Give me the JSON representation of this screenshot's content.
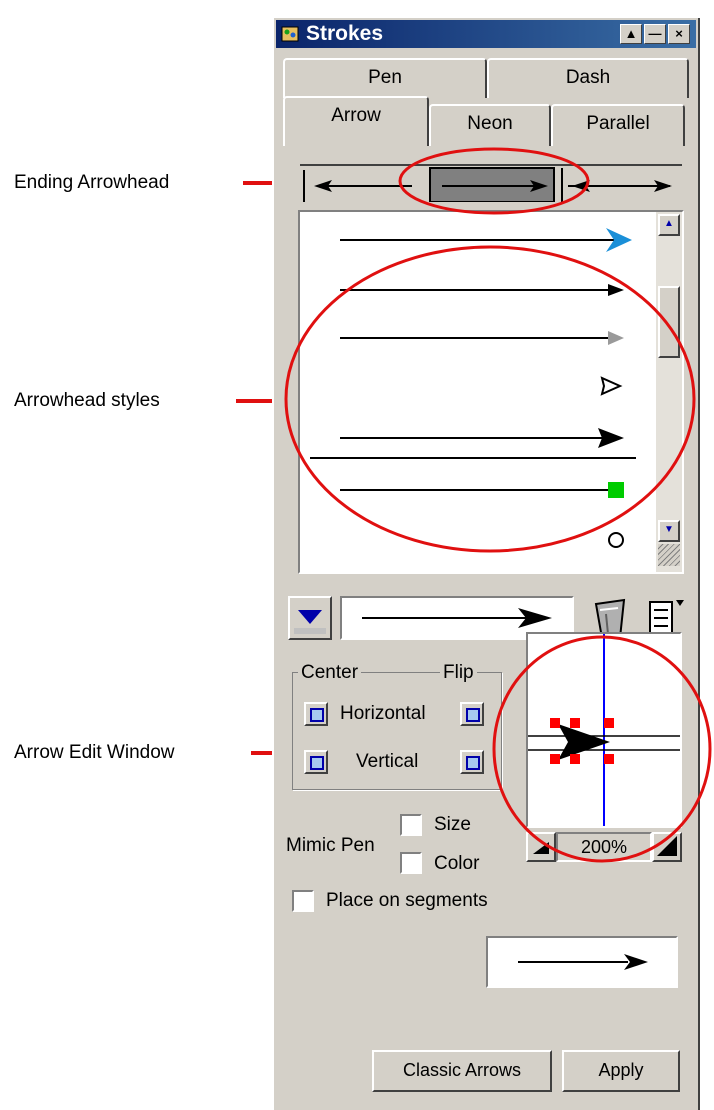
{
  "window": {
    "title": "Strokes",
    "icon": "paint-icon"
  },
  "tabs": {
    "row1": [
      {
        "label": "Pen"
      },
      {
        "label": "Dash"
      }
    ],
    "row2": [
      {
        "label": "Arrow"
      },
      {
        "label": "Neon"
      },
      {
        "label": "Parallel"
      }
    ]
  },
  "arrow_ends": [
    "start-arrowhead",
    "ending-arrowhead",
    "both-ends"
  ],
  "arrowhead_styles": [
    {
      "icon": "blue-arrowhead-icon",
      "color": "#1a8fd8"
    },
    {
      "icon": "black-small-arrowhead-icon",
      "color": "#000000"
    },
    {
      "icon": "gray-arrowhead-icon",
      "color": "#9a9a9a"
    },
    {
      "icon": "hollow-arrowhead-icon",
      "color": "#000000"
    },
    {
      "icon": "black-large-arrowhead-icon",
      "color": "#000000"
    },
    {
      "icon": "green-square-end-icon",
      "color": "#00cc00"
    },
    {
      "icon": "circle-end-icon",
      "color": "#000000"
    }
  ],
  "center_group": {
    "label": "Center"
  },
  "flip_group": {
    "label": "Flip"
  },
  "horizontal_label": "Horizontal",
  "vertical_label": "Vertical",
  "mimic_pen_label": "Mimic Pen",
  "size_label": "Size",
  "color_label": "Color",
  "place_on_segments_label": "Place on segments",
  "zoom_value": "200%",
  "buttons": {
    "classic_arrows": "Classic Arrows",
    "apply": "Apply"
  },
  "callouts": {
    "ending_arrowhead": "Ending Arrowhead",
    "arrowhead_styles": "Arrowhead styles",
    "arrow_edit_window": "Arrow Edit Window"
  },
  "colors": {
    "highlight_red": "#e01010",
    "guide_blue": "#0000ff"
  }
}
